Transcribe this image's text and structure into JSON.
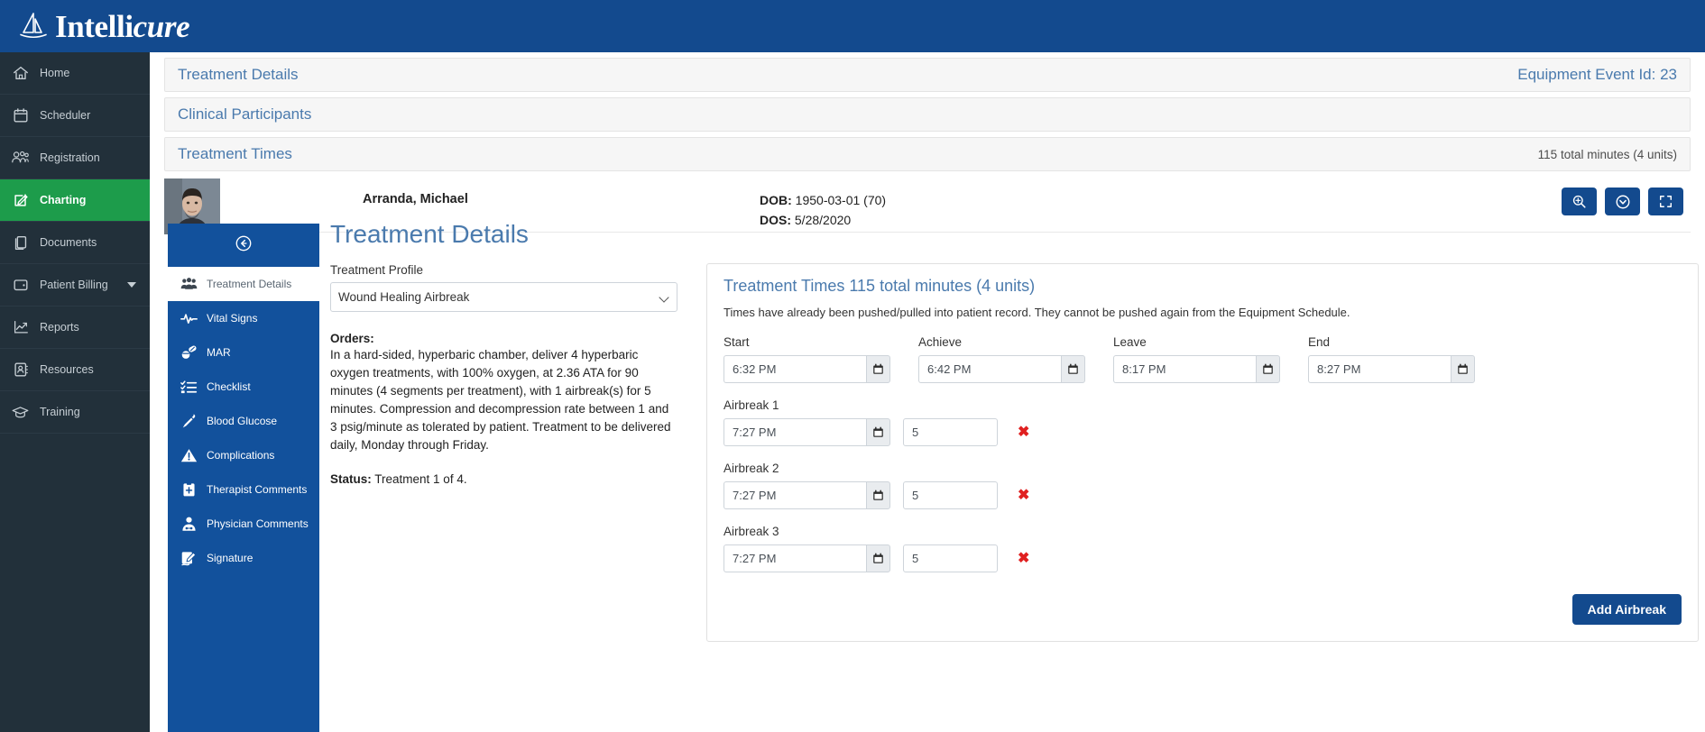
{
  "brand": {
    "name_first": "Intelli",
    "name_second": "cure",
    "logo_icon": "sailboat-icon"
  },
  "colors": {
    "brand_blue": "#134a8e",
    "sidebar_dark": "#22303a",
    "active_green": "#1d9c4b",
    "panel_blue": "#12519c",
    "link_blue": "#4a7aad",
    "danger_red": "#e02020"
  },
  "sidebar": {
    "items": [
      {
        "label": "Home",
        "icon": "home-icon",
        "active": false,
        "caret": false
      },
      {
        "label": "Scheduler",
        "icon": "calendar-icon",
        "active": false,
        "caret": false
      },
      {
        "label": "Registration",
        "icon": "users-icon",
        "active": false,
        "caret": false
      },
      {
        "label": "Charting",
        "icon": "edit-square-icon",
        "active": true,
        "caret": false
      },
      {
        "label": "Documents",
        "icon": "documents-icon",
        "active": false,
        "caret": false
      },
      {
        "label": "Patient Billing",
        "icon": "wallet-icon",
        "active": false,
        "caret": true
      },
      {
        "label": "Reports",
        "icon": "chart-line-icon",
        "active": false,
        "caret": false
      },
      {
        "label": "Resources",
        "icon": "contact-book-icon",
        "active": false,
        "caret": false
      },
      {
        "label": "Training",
        "icon": "graduation-cap-icon",
        "active": false,
        "caret": false
      }
    ]
  },
  "accordions": [
    {
      "title": "Treatment Details",
      "right": "Equipment Event Id: 23",
      "right_muted": false
    },
    {
      "title": "Clinical Participants",
      "right": "",
      "right_muted": false
    },
    {
      "title": "Treatment Times",
      "right": "115 total minutes (4 units)",
      "right_muted": true
    }
  ],
  "patient": {
    "name": "Arranda, Michael",
    "dob_label": "DOB:",
    "dob_value": "1950-03-01 (70)",
    "dos_label": "DOS:",
    "dos_value": "5/28/2020",
    "avatar_alt": "patient-photo"
  },
  "header_actions": [
    {
      "name": "zoom-in-button",
      "icon": "magnifier-plus-icon"
    },
    {
      "name": "check-circle-button",
      "icon": "chevron-down-circle-icon"
    },
    {
      "name": "fullscreen-button",
      "icon": "expand-icon"
    }
  ],
  "tabrail": {
    "back_icon": "arrow-left-circle-icon",
    "items": [
      {
        "label": "Treatment Details",
        "icon": "people-group-icon",
        "active": true
      },
      {
        "label": "Vital Signs",
        "icon": "heartbeat-icon",
        "active": false
      },
      {
        "label": "MAR",
        "icon": "pills-icon",
        "active": false
      },
      {
        "label": "Checklist",
        "icon": "checklist-icon",
        "active": false
      },
      {
        "label": "Blood Glucose",
        "icon": "lancet-icon",
        "active": false
      },
      {
        "label": "Complications",
        "icon": "warning-triangle-icon",
        "active": false
      },
      {
        "label": "Therapist Comments",
        "icon": "clipboard-plus-icon",
        "active": false
      },
      {
        "label": "Physician Comments",
        "icon": "doctor-icon",
        "active": false
      },
      {
        "label": "Signature",
        "icon": "signature-icon",
        "active": false
      }
    ]
  },
  "detail": {
    "title": "Treatment Details",
    "profile_label": "Treatment Profile",
    "profile_value": "Wound Healing Airbreak",
    "profile_options": [
      "Wound Healing Airbreak"
    ],
    "orders_label": "Orders:",
    "orders_text": "In a hard-sided, hyperbaric chamber, deliver 4 hyperbaric oxygen treatments, with 100% oxygen, at 2.36 ATA for 90 minutes (4 segments per treatment), with 1 airbreak(s) for 5 minutes. Compression and decompression rate between 1 and 3 psig/minute as tolerated by patient. Treatment to be delivered daily, Monday through Friday.",
    "status_label": "Status:",
    "status_value": "Treatment 1 of 4."
  },
  "times": {
    "title": "Treatment Times 115 total minutes (4 units)",
    "note": "Times have already been pushed/pulled into patient record. They cannot be pushed again from the Equipment Schedule.",
    "columns": [
      {
        "label": "Start",
        "value": "6:32 PM"
      },
      {
        "label": "Achieve",
        "value": "6:42 PM"
      },
      {
        "label": "Leave",
        "value": "8:17 PM"
      },
      {
        "label": "End",
        "value": "8:27 PM"
      }
    ],
    "airbreaks": [
      {
        "label": "Airbreak 1",
        "time": "7:27 PM",
        "minutes": "5",
        "remove": "✖"
      },
      {
        "label": "Airbreak 2",
        "time": "7:27 PM",
        "minutes": "5",
        "remove": "✖"
      },
      {
        "label": "Airbreak 3",
        "time": "7:27 PM",
        "minutes": "5",
        "remove": "✖"
      }
    ],
    "add_button": "Add Airbreak",
    "calendar_icon": "calendar-icon"
  }
}
